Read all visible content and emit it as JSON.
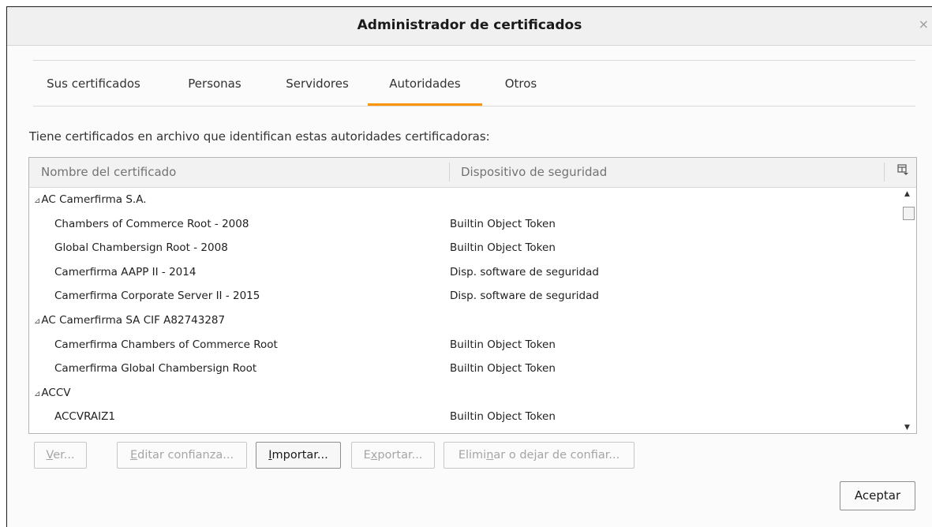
{
  "dialog": {
    "title": "Administrador de certificados",
    "close_glyph": "×"
  },
  "tabs": [
    {
      "label": "Sus certificados",
      "selected": false
    },
    {
      "label": "Personas",
      "selected": false
    },
    {
      "label": "Servidores",
      "selected": false
    },
    {
      "label": "Autoridades",
      "selected": true
    },
    {
      "label": "Otros",
      "selected": false
    }
  ],
  "intro_text": "Tiene certificados en archivo que identifican estas autoridades certificadoras:",
  "tree": {
    "columns": [
      "Nombre del certificado",
      "Dispositivo de seguridad"
    ],
    "twisty_glyph": "⊿",
    "rows": [
      {
        "type": "group",
        "name": "AC Camerfirma S.A."
      },
      {
        "type": "cert",
        "name": "Chambers of Commerce Root - 2008",
        "device": "Builtin Object Token"
      },
      {
        "type": "cert",
        "name": "Global Chambersign Root - 2008",
        "device": "Builtin Object Token"
      },
      {
        "type": "cert",
        "name": "Camerfirma AAPP II - 2014",
        "device": "Disp. software de seguridad"
      },
      {
        "type": "cert",
        "name": "Camerfirma Corporate Server II - 2015",
        "device": "Disp. software de seguridad"
      },
      {
        "type": "group",
        "name": "AC Camerfirma SA CIF A82743287"
      },
      {
        "type": "cert",
        "name": "Camerfirma Chambers of Commerce Root",
        "device": "Builtin Object Token"
      },
      {
        "type": "cert",
        "name": "Camerfirma Global Chambersign Root",
        "device": "Builtin Object Token"
      },
      {
        "type": "group",
        "name": "ACCV"
      },
      {
        "type": "cert",
        "name": "ACCVRAIZ1",
        "device": "Builtin Object Token"
      }
    ]
  },
  "buttons": {
    "ver": {
      "pre": "",
      "key": "V",
      "post": "er...",
      "enabled": false
    },
    "editar": {
      "pre": "",
      "key": "E",
      "post": "ditar confianza...",
      "enabled": false
    },
    "importar": {
      "pre": "",
      "key": "I",
      "post": "mportar...",
      "enabled": true
    },
    "exportar": {
      "pre": "E",
      "key": "x",
      "post": "portar...",
      "enabled": false
    },
    "eliminar": {
      "pre": "Elimi",
      "key": "n",
      "post": "ar o dejar de confiar...",
      "enabled": false
    },
    "aceptar": "Aceptar"
  },
  "colors": {
    "selected_tab_accent": "#ff9500",
    "disabled_text": "#a5a5a5"
  }
}
